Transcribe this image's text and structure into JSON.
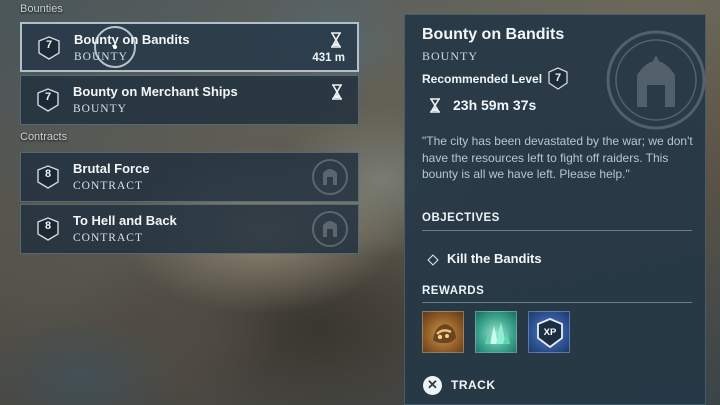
{
  "sections": {
    "bounties": "Bounties",
    "contracts": "Contracts"
  },
  "list": [
    {
      "level": "7",
      "title": "Bounty on Bandits",
      "type": "Bounty",
      "distance": "431 m",
      "icon": "hourglass-icon",
      "selected": true
    },
    {
      "level": "7",
      "title": "Bounty on Merchant Ships",
      "type": "Bounty",
      "icon": "hourglass-icon"
    },
    {
      "level": "8",
      "title": "Brutal Force",
      "type": "Contract",
      "icon": "mercenary-emblem-icon"
    },
    {
      "level": "8",
      "title": "To Hell and Back",
      "type": "Contract",
      "icon": "mercenary-emblem-icon"
    }
  ],
  "detail": {
    "title": "Bounty on Bandits",
    "type": "Bounty",
    "recommended_label": "Recommended Level",
    "recommended_level": "7",
    "timer": "23h 59m 37s",
    "description": "\"The city has been devastated by the war; we don't have the resources left to fight off raiders. This bounty is all we have left. Please help.\"",
    "objectives_heading": "OBJECTIVES",
    "objective": "Kill the Bandits",
    "rewards_heading": "REWARDS",
    "rewards": [
      "chest-loot-icon",
      "crystals-icon",
      "xp-badge-icon"
    ],
    "xp_label": "XP",
    "track_button_glyph": "✕",
    "track_label": "TRACK"
  },
  "colors": {
    "panel": "#263846",
    "card": "#20303e",
    "text": "#e8eef2"
  }
}
